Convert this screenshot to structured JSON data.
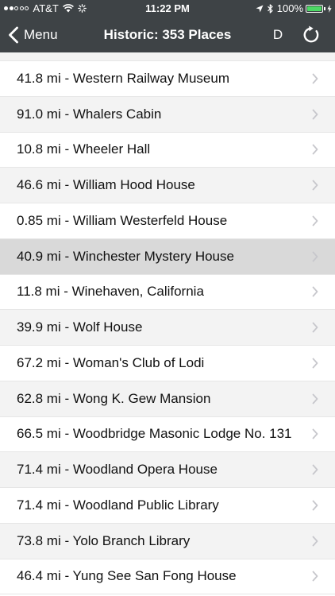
{
  "status_bar": {
    "carrier": "AT&T",
    "time": "11:22 PM",
    "battery_percent": "100%",
    "signal_bars_filled": 2,
    "signal_bars_total": 5,
    "battery_level": 1.0
  },
  "nav": {
    "back_label": "Menu",
    "title": "Historic: 353 Places",
    "d_label": "D"
  },
  "colors": {
    "bar_background": "#3e4346",
    "row_alt": "#f3f3f3",
    "row_selected": "#d9d9d9",
    "chevron": "#c7c7cc",
    "battery": "#4cd964"
  },
  "icons": {
    "back": "chevron-left-icon",
    "refresh": "refresh-icon",
    "row_disclosure": "chevron-right-icon",
    "wifi": "wifi-icon",
    "location": "location-arrow-icon",
    "bluetooth": "bluetooth-icon",
    "charging": "charging-bolt-icon"
  },
  "places": [
    {
      "label": "41.8 mi - Western Railway Museum",
      "selected": false
    },
    {
      "label": "91.0 mi - Whalers Cabin",
      "selected": false
    },
    {
      "label": "10.8 mi - Wheeler Hall",
      "selected": false
    },
    {
      "label": "46.6 mi - William Hood House",
      "selected": false
    },
    {
      "label": "0.85 mi - William Westerfeld House",
      "selected": false
    },
    {
      "label": "40.9 mi - Winchester Mystery House",
      "selected": true
    },
    {
      "label": "11.8 mi - Winehaven, California",
      "selected": false
    },
    {
      "label": "39.9 mi - Wolf House",
      "selected": false
    },
    {
      "label": "67.2 mi - Woman's Club of Lodi",
      "selected": false
    },
    {
      "label": "62.8 mi - Wong K. Gew Mansion",
      "selected": false
    },
    {
      "label": "66.5 mi - Woodbridge Masonic Lodge No. 131",
      "selected": false
    },
    {
      "label": "71.4 mi - Woodland Opera House",
      "selected": false
    },
    {
      "label": "71.4 mi - Woodland Public Library",
      "selected": false
    },
    {
      "label": "73.8 mi - Yolo Branch Library",
      "selected": false
    },
    {
      "label": "46.4 mi - Yung See San Fong House",
      "selected": false
    }
  ]
}
